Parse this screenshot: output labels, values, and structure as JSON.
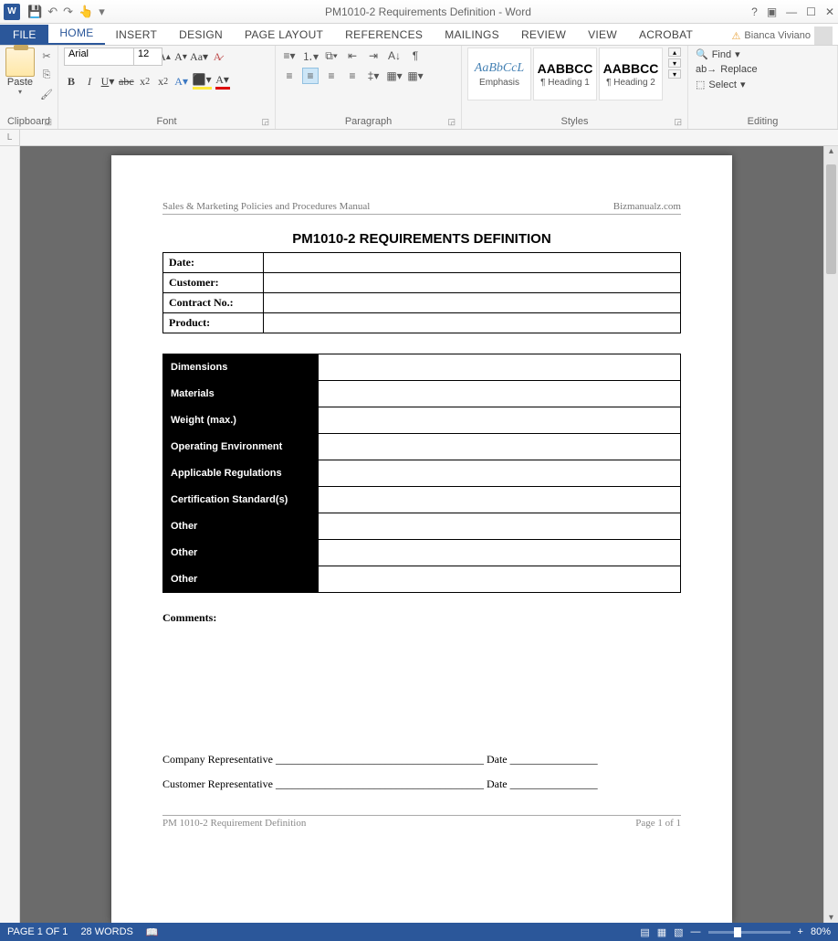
{
  "titlebar": {
    "app": "W",
    "title": "PM1010-2 Requirements Definition - Word"
  },
  "tabs": {
    "file": "FILE",
    "home": "HOME",
    "insert": "INSERT",
    "design": "DESIGN",
    "layout": "PAGE LAYOUT",
    "references": "REFERENCES",
    "mailings": "MAILINGS",
    "review": "REVIEW",
    "view": "VIEW",
    "acrobat": "ACROBAT"
  },
  "user": "Bianca Viviano",
  "ribbon": {
    "clipboard": {
      "paste": "Paste",
      "label": "Clipboard"
    },
    "font": {
      "name": "Arial",
      "size": "12",
      "label": "Font"
    },
    "paragraph": {
      "label": "Paragraph"
    },
    "styles": {
      "label": "Styles",
      "items": [
        {
          "preview": "AaBbCcL",
          "previewStyle": "font-style:italic;color:#4682b4;font-family:'Times New Roman'",
          "name": "Emphasis"
        },
        {
          "preview": "AABBCC",
          "previewStyle": "font-weight:bold",
          "name": "¶ Heading 1"
        },
        {
          "preview": "AABBCC",
          "previewStyle": "font-weight:bold",
          "name": "¶ Heading 2"
        }
      ]
    },
    "editing": {
      "label": "Editing",
      "find": "Find",
      "replace": "Replace",
      "select": "Select"
    }
  },
  "doc": {
    "headerLeft": "Sales & Marketing Policies and Procedures Manual",
    "headerRight": "Bizmanualz.com",
    "title": "PM1010-2 REQUIREMENTS DEFINITION",
    "info": [
      {
        "label": "Date:",
        "value": ""
      },
      {
        "label": "Customer:",
        "value": ""
      },
      {
        "label": "Contract No.:",
        "value": ""
      },
      {
        "label": "Product:",
        "value": ""
      }
    ],
    "specs": [
      "Dimensions",
      "Materials",
      "Weight (max.)",
      "Operating Environment",
      "Applicable Regulations",
      "Certification Standard(s)",
      "Other",
      "Other",
      "Other"
    ],
    "comments": "Comments:",
    "sig1": "Company Representative ______________________________________ Date ________________",
    "sig2": "Customer Representative ______________________________________ Date ________________",
    "footerLeft": "PM 1010-2 Requirement Definition",
    "footerRight": "Page 1 of 1"
  },
  "status": {
    "page": "PAGE 1 OF 1",
    "words": "28 WORDS",
    "zoom": "80%"
  }
}
